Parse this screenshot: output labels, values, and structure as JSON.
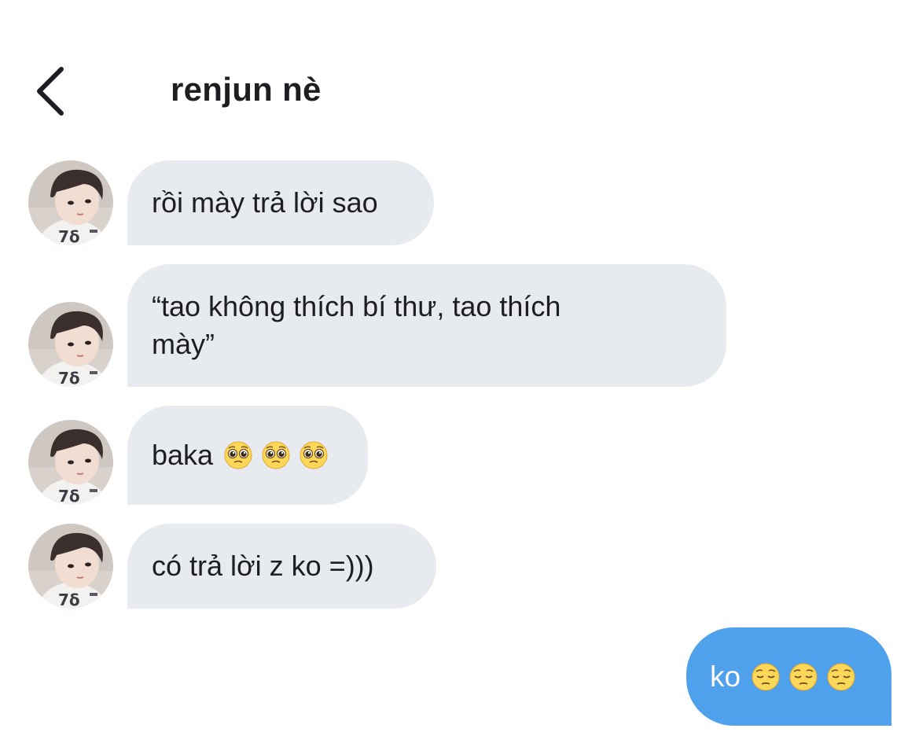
{
  "header": {
    "back_icon": "chevron-left-icon",
    "title": "renjun nè"
  },
  "messages": [
    {
      "sender": "renjun nè",
      "text": "rồi mày trả lời sao",
      "emojis": []
    },
    {
      "sender": "renjun nè",
      "text": "“tao không thích bí thư, tao thích\nmày”",
      "emojis": []
    },
    {
      "sender": "renjun nè",
      "text": "baka",
      "emojis": [
        "pleading-face-emoji",
        "pleading-face-emoji",
        "pleading-face-emoji"
      ]
    },
    {
      "sender": "renjun nè",
      "text": "có trả lời z ko =)))",
      "emojis": []
    }
  ],
  "outgoing": {
    "text": "ko",
    "emojis": [
      "pensive-face-emoji",
      "pensive-face-emoji",
      "pensive-face-emoji"
    ]
  },
  "colors": {
    "incoming_bubble": "#e7ebf0",
    "outgoing_bubble": "#4ea1ea",
    "text": "#1c1e21",
    "background": "#ffffff"
  }
}
